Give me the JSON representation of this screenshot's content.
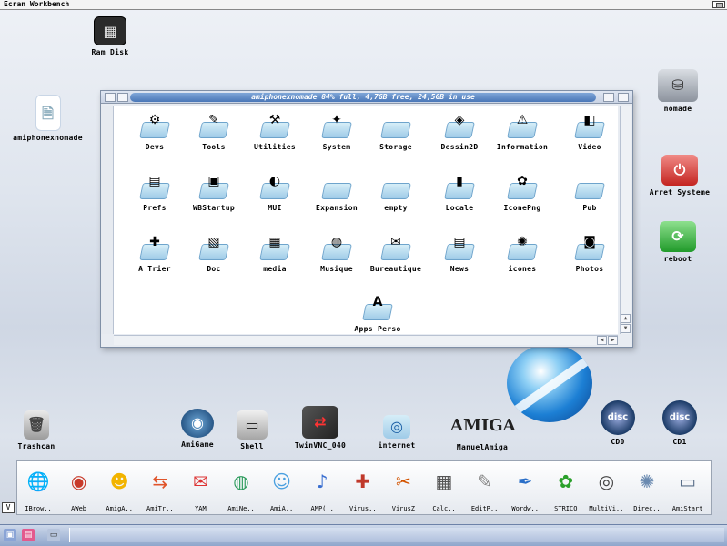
{
  "screen": {
    "title": "Ecran Workbench"
  },
  "desktop_icons": [
    {
      "name": "ram-disk",
      "label": "Ram Disk",
      "glyph": "▦"
    },
    {
      "name": "amiphonexnomade",
      "label": "amiphonexnomade",
      "glyph": "🗎"
    },
    {
      "name": "nomade",
      "label": "nomade",
      "glyph": "⛁"
    },
    {
      "name": "arret-systeme",
      "label": "Arret Systeme",
      "glyph": "⏻"
    },
    {
      "name": "reboot",
      "label": "reboot",
      "glyph": "⟳"
    },
    {
      "name": "trashcan",
      "label": "Trashcan",
      "glyph": "🗑"
    },
    {
      "name": "amigame",
      "label": "AmiGame",
      "glyph": "◉"
    },
    {
      "name": "shell",
      "label": "Shell",
      "glyph": "▭"
    },
    {
      "name": "twinvnc",
      "label": "TwinVNC_040",
      "glyph": "⇄"
    },
    {
      "name": "internet",
      "label": "internet",
      "glyph": "◎"
    },
    {
      "name": "manuelamiga",
      "label": "ManuelAmiga",
      "glyph": "AMIGA"
    },
    {
      "name": "cd0",
      "label": "CD0",
      "glyph": "disc"
    },
    {
      "name": "cd1",
      "label": "CD1",
      "glyph": "disc"
    }
  ],
  "window": {
    "title": "amiphonexnomade  84% full, 4,7GB free, 24,5GB in use",
    "drawers": [
      {
        "label": "Devs",
        "glyph": "⚙"
      },
      {
        "label": "Tools",
        "glyph": "✎"
      },
      {
        "label": "Utilities",
        "glyph": "⚒"
      },
      {
        "label": "System",
        "glyph": "✦"
      },
      {
        "label": "Storage",
        "glyph": ""
      },
      {
        "label": "Dessin2D",
        "glyph": "◈"
      },
      {
        "label": "Information",
        "glyph": "⚠"
      },
      {
        "label": "Video",
        "glyph": "◧"
      },
      {
        "label": "Prefs",
        "glyph": "▤"
      },
      {
        "label": "WBStartup",
        "glyph": "▣"
      },
      {
        "label": "MUI",
        "glyph": "◐"
      },
      {
        "label": "Expansion",
        "glyph": ""
      },
      {
        "label": "empty",
        "glyph": ""
      },
      {
        "label": "Locale",
        "glyph": "▮"
      },
      {
        "label": "IconePng",
        "glyph": "✿"
      },
      {
        "label": "Pub",
        "glyph": ""
      },
      {
        "label": "A Trier",
        "glyph": "✚"
      },
      {
        "label": "Doc",
        "glyph": "▧"
      },
      {
        "label": "media",
        "glyph": "▦"
      },
      {
        "label": "Musique",
        "glyph": "◍"
      },
      {
        "label": "Bureautique",
        "glyph": "✉"
      },
      {
        "label": "News",
        "glyph": "▤"
      },
      {
        "label": "icones",
        "glyph": "✺"
      },
      {
        "label": "Photos",
        "glyph": "◙"
      },
      {
        "label": "Apps Perso",
        "glyph": "A"
      }
    ]
  },
  "dock": {
    "toggle": "V",
    "items": [
      {
        "label": "IBrow..",
        "glyph": "🌐"
      },
      {
        "label": "AWeb",
        "glyph": "◉"
      },
      {
        "label": "AmigA..",
        "glyph": "☻"
      },
      {
        "label": "AmiTr..",
        "glyph": "⇆"
      },
      {
        "label": "YAM",
        "glyph": "✉"
      },
      {
        "label": "AmiNe..",
        "glyph": "◍"
      },
      {
        "label": "AmiA..",
        "glyph": "☺"
      },
      {
        "label": "AMP(..",
        "glyph": "♪"
      },
      {
        "label": "Virus..",
        "glyph": "✚"
      },
      {
        "label": "VirusZ",
        "glyph": "✂"
      },
      {
        "label": "Calc..",
        "glyph": "▦"
      },
      {
        "label": "EditP..",
        "glyph": "✎"
      },
      {
        "label": "Wordw..",
        "glyph": "✒"
      },
      {
        "label": "STRICQ",
        "glyph": "✿"
      },
      {
        "label": "MultiVi..",
        "glyph": "◎"
      },
      {
        "label": "Direc..",
        "glyph": "✺"
      },
      {
        "label": "AmiStart",
        "glyph": "▭"
      }
    ]
  },
  "colors": {
    "title_bar_blue": "#4a77b7",
    "drawer_fill": "#9fcbe8",
    "reboot_green": "#2fae3a",
    "arret_red": "#d8302c"
  }
}
